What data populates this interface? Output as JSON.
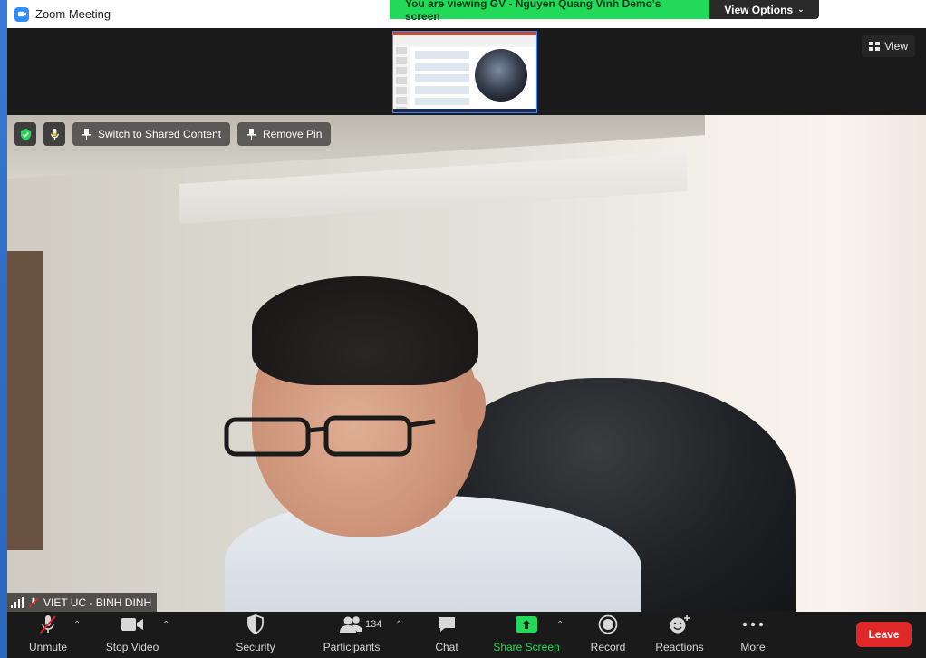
{
  "window": {
    "title": "Zoom Meeting"
  },
  "banner": {
    "viewing_text": "You are viewing GV - Nguyen Quang Vinh Demo's screen",
    "view_options_label": "View Options"
  },
  "header": {
    "view_label": "View"
  },
  "video": {
    "switch_label": "Switch to Shared Content",
    "remove_pin_label": "Remove Pin",
    "participant_name": "VIET UC - BINH DINH"
  },
  "toolbar": {
    "unmute_label": "Unmute",
    "stop_video_label": "Stop Video",
    "security_label": "Security",
    "participants_label": "Participants",
    "participants_count": "134",
    "chat_label": "Chat",
    "share_label": "Share Screen",
    "record_label": "Record",
    "reactions_label": "Reactions",
    "more_label": "More",
    "leave_label": "Leave"
  },
  "colors": {
    "banner_green": "#23d959",
    "leave_red": "#e02828",
    "zoom_blue": "#2d8cff",
    "toolbar_bg": "#1a1a1a"
  }
}
